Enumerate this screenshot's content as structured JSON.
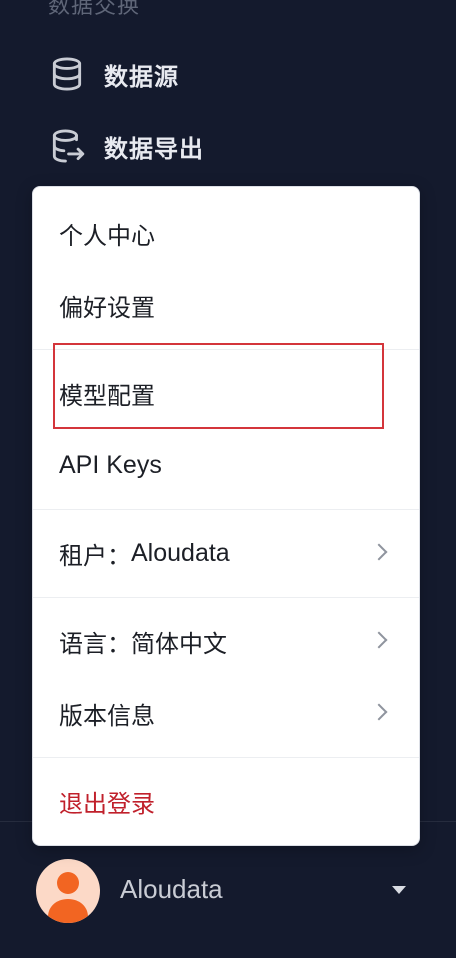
{
  "sidebar": {
    "section_header": "数据交换",
    "items": [
      {
        "label": "数据源",
        "icon": "database-icon"
      },
      {
        "label": "数据导出",
        "icon": "database-export-icon"
      }
    ]
  },
  "menu": {
    "items": {
      "profile": "个人中心",
      "preferences": "偏好设置",
      "model_config": "模型配置",
      "api_keys": "API Keys",
      "tenant_prefix": "租户：",
      "tenant_value": "Aloudata",
      "language_prefix": "语言：",
      "language_value": "简体中文",
      "version": "版本信息",
      "logout": "退出登录"
    },
    "highlighted_item": "model_config",
    "highlight_color": "#d4353b"
  },
  "user": {
    "name": "Aloudata",
    "avatar_icon": "user-avatar-icon"
  },
  "colors": {
    "background": "#141a2d",
    "logout": "#c0202b",
    "avatar_accent": "#f26522"
  }
}
